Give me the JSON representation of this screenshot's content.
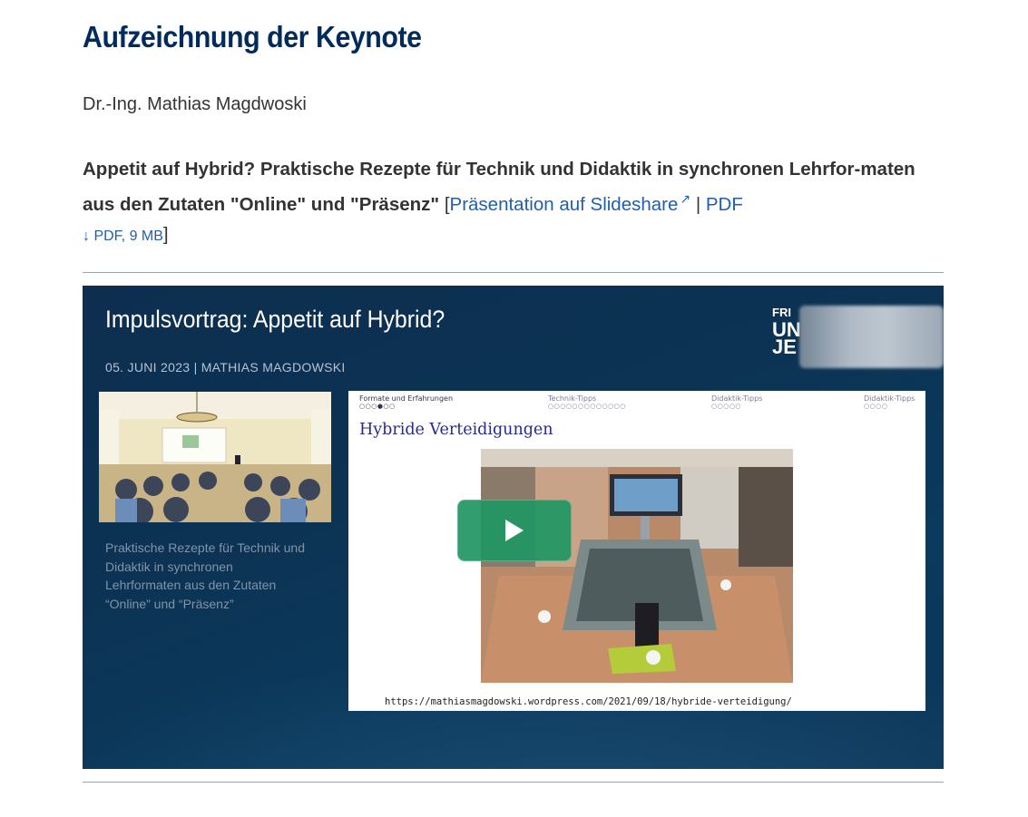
{
  "page": {
    "title": "Aufzeichnung der Keynote",
    "author": "Dr.-Ing. Mathias Magdwoski",
    "talk_title": "Appetit auf Hybrid? Praktische Rezepte für Technik und Didaktik in synchronen Lehrfor-maten aus den Zutaten \"Online\" und \"Präsenz\"",
    "bracket_open": "[",
    "slideshare_link": "Präsentation auf Slideshare",
    "separator": "|",
    "pdf_link": "PDF",
    "pdf_download": "PDF, 9 MB",
    "bracket_close": "]"
  },
  "video": {
    "title": "Impulsvortrag: Appetit auf Hybrid?",
    "subtitle": "05. JUNI 2023 | MATHIAS MAGDOWSKI",
    "logo_lines": [
      "FRI",
      "UN",
      "JE"
    ],
    "caption": "Praktische Rezepte für Technik und Didaktik in synchronen Lehrformaten aus den Zutaten “Online” und “Präsenz”",
    "slide": {
      "sections": [
        {
          "label": "Formate und Erfahrungen",
          "dots": "○○○●○○"
        },
        {
          "label": "Technik-Tipps",
          "dots": "○○○○○○○○○○○○○"
        },
        {
          "label": "Didaktik-Tipps",
          "dots": "○○○○○"
        },
        {
          "label": "Didaktik-Tipps",
          "dots": "○○○○"
        }
      ],
      "heading": "Hybride Verteidigungen",
      "url": "https://mathiasmagdowski.wordpress.com/2021/09/18/hybride-verteidigung/"
    },
    "play_icon": "play-icon"
  },
  "colors": {
    "title": "#002b5c",
    "link": "#1f5fad",
    "video_bg": "#0d2e4f",
    "play_button": "#219663"
  }
}
